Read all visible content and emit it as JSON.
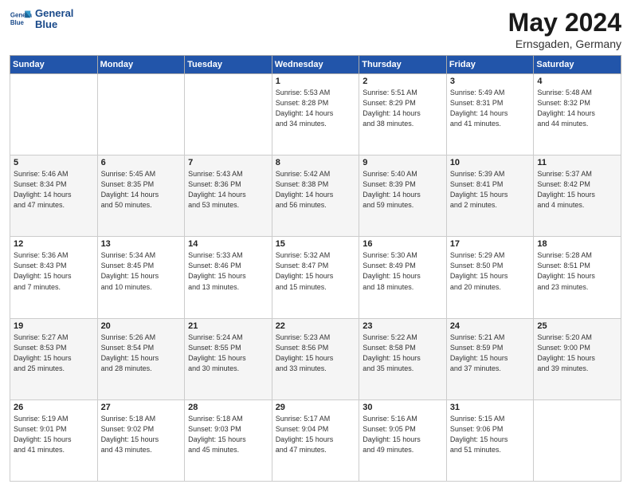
{
  "header": {
    "logo_line1": "General",
    "logo_line2": "Blue",
    "month": "May 2024",
    "location": "Ernsgaden, Germany"
  },
  "days_of_week": [
    "Sunday",
    "Monday",
    "Tuesday",
    "Wednesday",
    "Thursday",
    "Friday",
    "Saturday"
  ],
  "weeks": [
    [
      {
        "day": "",
        "detail": ""
      },
      {
        "day": "",
        "detail": ""
      },
      {
        "day": "",
        "detail": ""
      },
      {
        "day": "1",
        "detail": "Sunrise: 5:53 AM\nSunset: 8:28 PM\nDaylight: 14 hours\nand 34 minutes."
      },
      {
        "day": "2",
        "detail": "Sunrise: 5:51 AM\nSunset: 8:29 PM\nDaylight: 14 hours\nand 38 minutes."
      },
      {
        "day": "3",
        "detail": "Sunrise: 5:49 AM\nSunset: 8:31 PM\nDaylight: 14 hours\nand 41 minutes."
      },
      {
        "day": "4",
        "detail": "Sunrise: 5:48 AM\nSunset: 8:32 PM\nDaylight: 14 hours\nand 44 minutes."
      }
    ],
    [
      {
        "day": "5",
        "detail": "Sunrise: 5:46 AM\nSunset: 8:34 PM\nDaylight: 14 hours\nand 47 minutes."
      },
      {
        "day": "6",
        "detail": "Sunrise: 5:45 AM\nSunset: 8:35 PM\nDaylight: 14 hours\nand 50 minutes."
      },
      {
        "day": "7",
        "detail": "Sunrise: 5:43 AM\nSunset: 8:36 PM\nDaylight: 14 hours\nand 53 minutes."
      },
      {
        "day": "8",
        "detail": "Sunrise: 5:42 AM\nSunset: 8:38 PM\nDaylight: 14 hours\nand 56 minutes."
      },
      {
        "day": "9",
        "detail": "Sunrise: 5:40 AM\nSunset: 8:39 PM\nDaylight: 14 hours\nand 59 minutes."
      },
      {
        "day": "10",
        "detail": "Sunrise: 5:39 AM\nSunset: 8:41 PM\nDaylight: 15 hours\nand 2 minutes."
      },
      {
        "day": "11",
        "detail": "Sunrise: 5:37 AM\nSunset: 8:42 PM\nDaylight: 15 hours\nand 4 minutes."
      }
    ],
    [
      {
        "day": "12",
        "detail": "Sunrise: 5:36 AM\nSunset: 8:43 PM\nDaylight: 15 hours\nand 7 minutes."
      },
      {
        "day": "13",
        "detail": "Sunrise: 5:34 AM\nSunset: 8:45 PM\nDaylight: 15 hours\nand 10 minutes."
      },
      {
        "day": "14",
        "detail": "Sunrise: 5:33 AM\nSunset: 8:46 PM\nDaylight: 15 hours\nand 13 minutes."
      },
      {
        "day": "15",
        "detail": "Sunrise: 5:32 AM\nSunset: 8:47 PM\nDaylight: 15 hours\nand 15 minutes."
      },
      {
        "day": "16",
        "detail": "Sunrise: 5:30 AM\nSunset: 8:49 PM\nDaylight: 15 hours\nand 18 minutes."
      },
      {
        "day": "17",
        "detail": "Sunrise: 5:29 AM\nSunset: 8:50 PM\nDaylight: 15 hours\nand 20 minutes."
      },
      {
        "day": "18",
        "detail": "Sunrise: 5:28 AM\nSunset: 8:51 PM\nDaylight: 15 hours\nand 23 minutes."
      }
    ],
    [
      {
        "day": "19",
        "detail": "Sunrise: 5:27 AM\nSunset: 8:53 PM\nDaylight: 15 hours\nand 25 minutes."
      },
      {
        "day": "20",
        "detail": "Sunrise: 5:26 AM\nSunset: 8:54 PM\nDaylight: 15 hours\nand 28 minutes."
      },
      {
        "day": "21",
        "detail": "Sunrise: 5:24 AM\nSunset: 8:55 PM\nDaylight: 15 hours\nand 30 minutes."
      },
      {
        "day": "22",
        "detail": "Sunrise: 5:23 AM\nSunset: 8:56 PM\nDaylight: 15 hours\nand 33 minutes."
      },
      {
        "day": "23",
        "detail": "Sunrise: 5:22 AM\nSunset: 8:58 PM\nDaylight: 15 hours\nand 35 minutes."
      },
      {
        "day": "24",
        "detail": "Sunrise: 5:21 AM\nSunset: 8:59 PM\nDaylight: 15 hours\nand 37 minutes."
      },
      {
        "day": "25",
        "detail": "Sunrise: 5:20 AM\nSunset: 9:00 PM\nDaylight: 15 hours\nand 39 minutes."
      }
    ],
    [
      {
        "day": "26",
        "detail": "Sunrise: 5:19 AM\nSunset: 9:01 PM\nDaylight: 15 hours\nand 41 minutes."
      },
      {
        "day": "27",
        "detail": "Sunrise: 5:18 AM\nSunset: 9:02 PM\nDaylight: 15 hours\nand 43 minutes."
      },
      {
        "day": "28",
        "detail": "Sunrise: 5:18 AM\nSunset: 9:03 PM\nDaylight: 15 hours\nand 45 minutes."
      },
      {
        "day": "29",
        "detail": "Sunrise: 5:17 AM\nSunset: 9:04 PM\nDaylight: 15 hours\nand 47 minutes."
      },
      {
        "day": "30",
        "detail": "Sunrise: 5:16 AM\nSunset: 9:05 PM\nDaylight: 15 hours\nand 49 minutes."
      },
      {
        "day": "31",
        "detail": "Sunrise: 5:15 AM\nSunset: 9:06 PM\nDaylight: 15 hours\nand 51 minutes."
      },
      {
        "day": "",
        "detail": ""
      }
    ]
  ]
}
